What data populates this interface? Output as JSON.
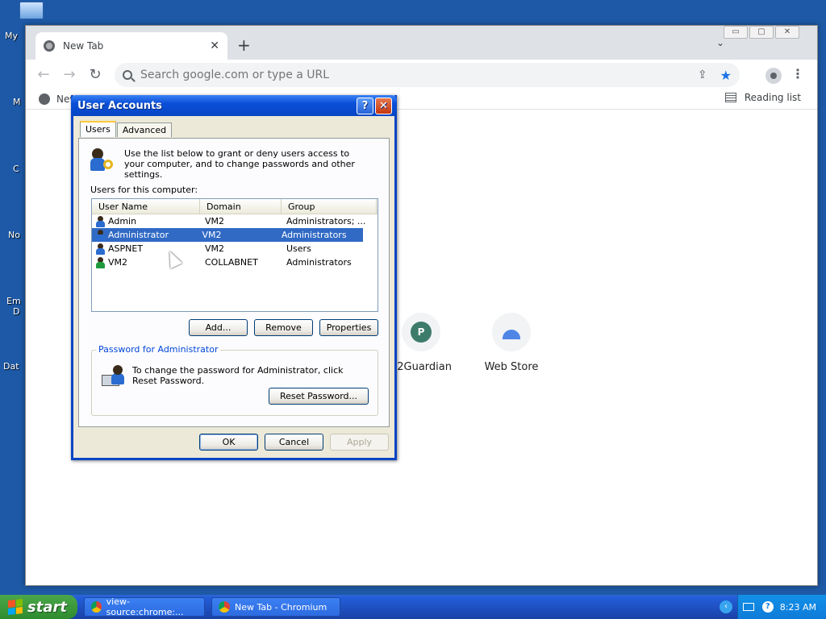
{
  "desktop": {
    "labels": [
      "My",
      "M",
      "C",
      "No",
      "Em",
      "D",
      "Dat"
    ]
  },
  "browser": {
    "tab_title": "New Tab",
    "tab_close": "✕",
    "new_tab": "+",
    "tab_dropdown": "⌄",
    "window_controls": [
      "▭",
      "▢",
      "✕"
    ],
    "omnibox_placeholder": "Search google.com or type a URL",
    "bookmark_item": "New",
    "reading_list": "Reading list",
    "shortcuts": [
      {
        "label": "E2Guardian",
        "initial": "P"
      },
      {
        "label": "Web Store"
      }
    ]
  },
  "dialog": {
    "title": "User Accounts",
    "help_button": "?",
    "close_button": "✕",
    "tabs": [
      "Users",
      "Advanced"
    ],
    "intro_text": "Use the list below to grant or deny users access to your computer, and to change passwords and other settings.",
    "users_label": "Users for this computer:",
    "columns": [
      "User Name",
      "Domain",
      "Group"
    ],
    "users": [
      {
        "name": "Admin",
        "domain": "VM2",
        "group": "Administrators; ..."
      },
      {
        "name": "Administrator",
        "domain": "VM2",
        "group": "Administrators"
      },
      {
        "name": "ASPNET",
        "domain": "VM2",
        "group": "Users"
      },
      {
        "name": "VM2",
        "domain": "COLLABNET",
        "group": "Administrators"
      }
    ],
    "selected_user": "Administrator",
    "buttons": {
      "add": "Add...",
      "remove": "Remove",
      "properties": "Properties",
      "reset_password": "Reset Password...",
      "ok": "OK",
      "cancel": "Cancel",
      "apply": "Apply"
    },
    "password_group_title": "Password for Administrator",
    "password_text": "To change the password for Administrator, click Reset Password."
  },
  "taskbar": {
    "start": "start",
    "items": [
      "view-source:chrome:...",
      "New Tab - Chromium"
    ],
    "clock": "8:23 AM",
    "tray_help": "?",
    "collapse": "‹"
  }
}
